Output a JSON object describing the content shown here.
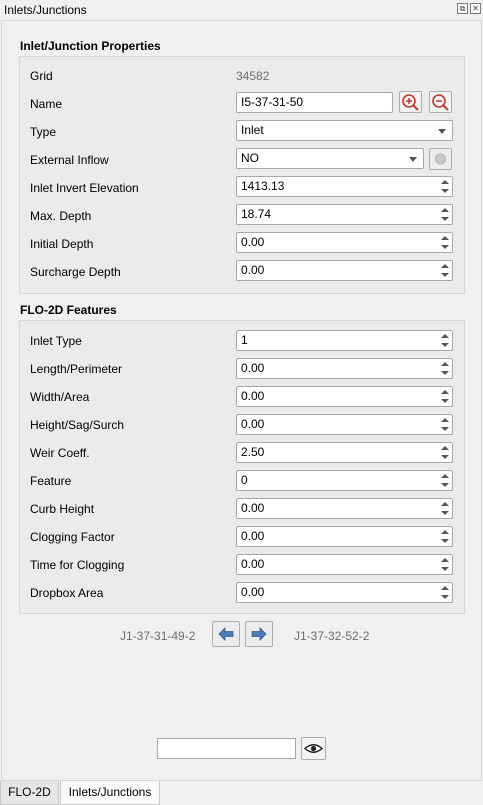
{
  "window": {
    "title": "Inlets/Junctions"
  },
  "props": {
    "section_title": "Inlet/Junction Properties",
    "grid_label": "Grid",
    "grid_value": "34582",
    "name_label": "Name",
    "name_value": "I5-37-31-50",
    "type_label": "Type",
    "type_value": "Inlet",
    "external_inflow_label": "External Inflow",
    "external_inflow_value": "NO",
    "invert_label": "Inlet Invert Elevation",
    "invert_value": "1413.13",
    "max_depth_label": "Max. Depth",
    "max_depth_value": "18.74",
    "initial_depth_label": "Initial Depth",
    "initial_depth_value": "0.00",
    "surcharge_label": "Surcharge Depth",
    "surcharge_value": "0.00"
  },
  "features": {
    "section_title": "FLO-2D Features",
    "rows": [
      {
        "label": "Inlet Type",
        "value": "1"
      },
      {
        "label": "Length/Perimeter",
        "value": "0.00"
      },
      {
        "label": "Width/Area",
        "value": "0.00"
      },
      {
        "label": "Height/Sag/Surch",
        "value": "0.00"
      },
      {
        "label": "Weir Coeff.",
        "value": "2.50"
      },
      {
        "label": "Feature",
        "value": "0"
      },
      {
        "label": "Curb Height",
        "value": "0.00"
      },
      {
        "label": "Clogging Factor",
        "value": "0.00"
      },
      {
        "label": "Time for Clogging",
        "value": "0.00"
      },
      {
        "label": "Dropbox Area",
        "value": "0.00"
      }
    ]
  },
  "navigation": {
    "previous_label": "J1-37-31-49-2",
    "next_label": "J1-37-32-52-2"
  },
  "tabs": [
    {
      "label": "FLO-2D"
    },
    {
      "label": "Inlets/Junctions"
    }
  ],
  "colors": {
    "accent": "#4a7db5",
    "zoom_out_red": "#c0392b"
  }
}
